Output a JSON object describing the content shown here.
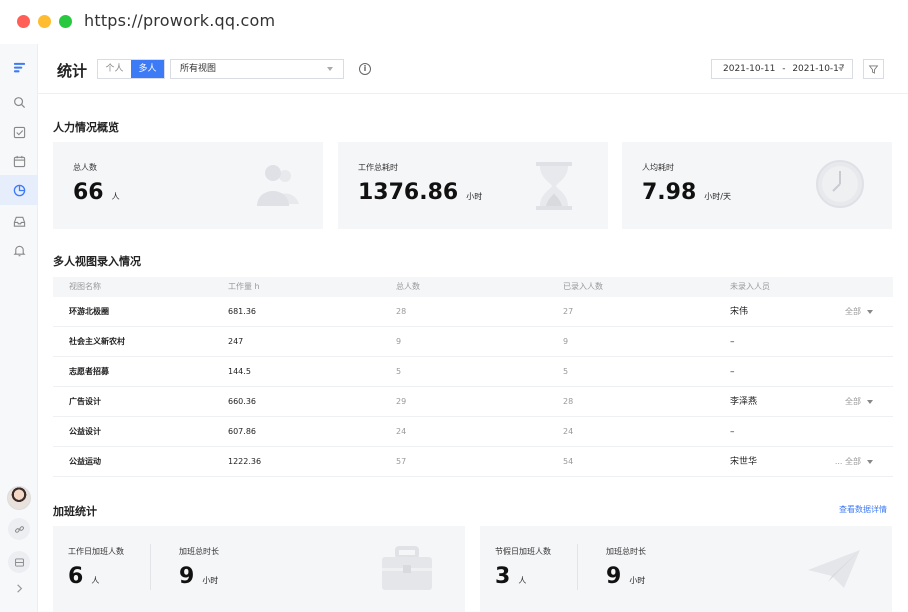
{
  "browser": {
    "url": "https://prowork.qq.com"
  },
  "header": {
    "title": "统计",
    "segments": [
      "个人",
      "多人"
    ],
    "active_segment": "多人",
    "view_select": "所有视图",
    "date_start": "2021-10-11",
    "date_end": "2021-10-17",
    "date_separator": "-"
  },
  "overview": {
    "title": "人力情况概览",
    "cards": [
      {
        "label": "总人数",
        "value": "66",
        "unit": "人",
        "icon": "people-icon"
      },
      {
        "label": "工作总耗时",
        "value": "1376.86",
        "unit": "小时",
        "icon": "hourglass-icon"
      },
      {
        "label": "人均耗时",
        "value": "7.98",
        "unit": "小时/天",
        "icon": "clock-icon"
      }
    ]
  },
  "entry": {
    "title": "多人视图录入情况",
    "columns": [
      "视图名称",
      "工作量 h",
      "总人数",
      "已录入人数",
      "未录入人员"
    ],
    "rows": [
      {
        "name": "环游北极圈",
        "hours": "681.36",
        "total": "28",
        "entered": "27",
        "missing": "宋伟",
        "more": "全部"
      },
      {
        "name": "社会主义新农村",
        "hours": "247",
        "total": "9",
        "entered": "9",
        "missing": "–",
        "more": ""
      },
      {
        "name": "志愿者招募",
        "hours": "144.5",
        "total": "5",
        "entered": "5",
        "missing": "–",
        "more": ""
      },
      {
        "name": "广告设计",
        "hours": "660.36",
        "total": "29",
        "entered": "28",
        "missing": "李泽燕",
        "more": "全部"
      },
      {
        "name": "公益设计",
        "hours": "607.86",
        "total": "24",
        "entered": "24",
        "missing": "–",
        "more": ""
      },
      {
        "name": "公益运动",
        "hours": "1222.36",
        "total": "57",
        "entered": "54",
        "missing": "宋世华",
        "more": "... 全部"
      }
    ]
  },
  "overtime": {
    "title": "加班统计",
    "detail_link": "查看数据详情",
    "cards": [
      {
        "count_label": "工作日加班人数",
        "count": "6",
        "count_unit": "人",
        "hours_label": "加班总时长",
        "hours": "9",
        "hours_unit": "小时",
        "icon": "briefcase-icon"
      },
      {
        "count_label": "节假日加班人数",
        "count": "3",
        "count_unit": "人",
        "hours_label": "加班总时长",
        "hours": "9",
        "hours_unit": "小时",
        "icon": "paper-plane-icon"
      }
    ]
  },
  "colors": {
    "accent": "#3d7af5",
    "card_bg": "#f5f6f8"
  }
}
